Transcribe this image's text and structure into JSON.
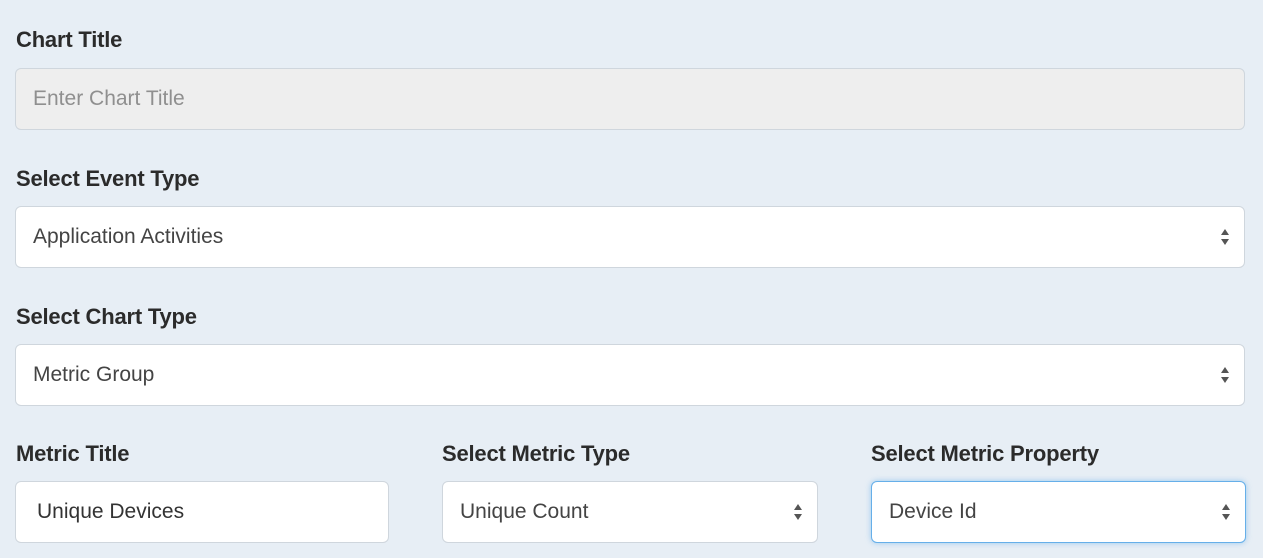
{
  "chart_title": {
    "label": "Chart Title",
    "placeholder": "Enter Chart Title",
    "value": ""
  },
  "event_type": {
    "label": "Select Event Type",
    "selected": "Application Activities"
  },
  "chart_type": {
    "label": "Select Chart Type",
    "selected": "Metric Group"
  },
  "metric_title": {
    "label": "Metric Title",
    "value": "Unique Devices"
  },
  "metric_type": {
    "label": "Select Metric Type",
    "selected": "Unique Count"
  },
  "metric_property": {
    "label": "Select Metric Property",
    "selected": "Device Id"
  },
  "colors": {
    "panel_bg": "#e7eef5",
    "focus_border": "#66afe9",
    "disabled_bg": "#eeeeee"
  },
  "icons": {
    "select_arrows": "select-arrows-icon"
  }
}
